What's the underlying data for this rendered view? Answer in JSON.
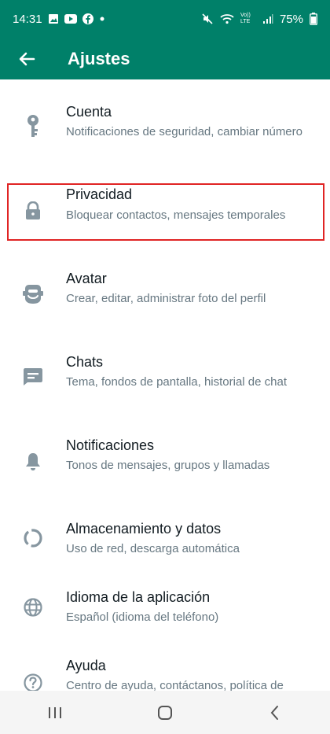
{
  "status_bar": {
    "time": "14:31",
    "battery": "75%",
    "volte": "Vo)) LTE"
  },
  "header": {
    "title": "Ajustes"
  },
  "settings": [
    {
      "title": "Cuenta",
      "subtitle": "Notificaciones de seguridad, cambiar número",
      "icon": "key-icon"
    },
    {
      "title": "Privacidad",
      "subtitle": "Bloquear contactos, mensajes temporales",
      "icon": "lock-icon"
    },
    {
      "title": "Avatar",
      "subtitle": "Crear, editar, administrar foto del perfil",
      "icon": "avatar-icon"
    },
    {
      "title": "Chats",
      "subtitle": "Tema, fondos de pantalla, historial de chat",
      "icon": "chat-icon"
    },
    {
      "title": "Notificaciones",
      "subtitle": "Tonos de mensajes, grupos y llamadas",
      "icon": "bell-icon"
    },
    {
      "title": "Almacenamiento y datos",
      "subtitle": "Uso de red, descarga automática",
      "icon": "storage-icon"
    },
    {
      "title": "Idioma de la aplicación",
      "subtitle": "Español (idioma del teléfono)",
      "icon": "globe-icon"
    },
    {
      "title": "Ayuda",
      "subtitle": "Centro de ayuda, contáctanos, política de",
      "icon": "help-icon"
    }
  ],
  "colors": {
    "header": "#008069",
    "icon": "#8696a0",
    "highlight": "#e02424"
  }
}
